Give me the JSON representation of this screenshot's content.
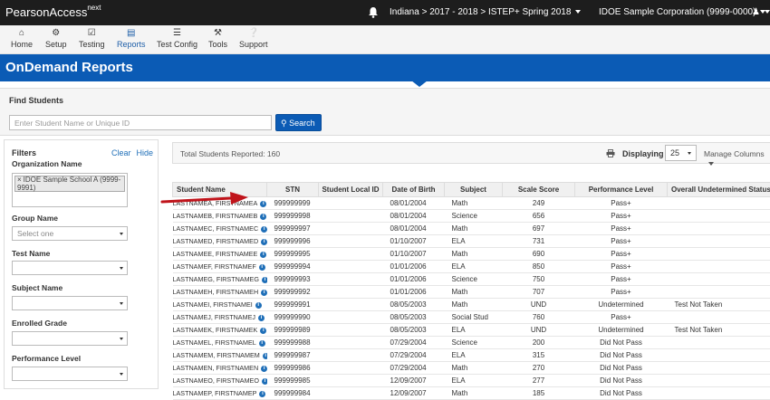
{
  "app": {
    "brand": "PearsonAccess",
    "brand_sup": "next",
    "context": "Indiana > 2017 - 2018 > ISTEP+ Spring 2018",
    "organization": "IDOE Sample Corporation (9999-0000)"
  },
  "nav": {
    "items": [
      {
        "label": "Home",
        "icon": "home-icon"
      },
      {
        "label": "Setup",
        "icon": "gear-icon"
      },
      {
        "label": "Testing",
        "icon": "checkbox-icon"
      },
      {
        "label": "Reports",
        "icon": "report-icon"
      },
      {
        "label": "Test Config",
        "icon": "list-icon"
      },
      {
        "label": "Tools",
        "icon": "wrench-icon"
      },
      {
        "label": "Support",
        "icon": "help-icon"
      }
    ],
    "active": "Reports"
  },
  "banner": {
    "title": "OnDemand Reports"
  },
  "find": {
    "title": "Find Students",
    "placeholder": "Enter Student Name or Unique ID",
    "search_label": "Search"
  },
  "filters": {
    "title": "Filters",
    "clear": "Clear",
    "hide": "Hide",
    "org_label": "Organization Name",
    "org_chip": "IDOE Sample School A (9999-9991)",
    "org_chip_x": "×",
    "group_label": "Group Name",
    "group_value": "Select one",
    "test_label": "Test Name",
    "subject_label": "Subject Name",
    "grade_label": "Enrolled Grade",
    "perf_label": "Performance Level"
  },
  "results": {
    "total": "Total Students Reported: 160",
    "displaying_label": "Displaying",
    "displaying_value": "25",
    "manage_columns": "Manage Columns"
  },
  "table": {
    "headers": [
      "Student Name",
      "STN",
      "Student Local ID",
      "Date of Birth",
      "Subject",
      "Scale Score",
      "Performance Level",
      "Overall Undetermined Status"
    ],
    "rows": [
      [
        "LASTNAMEA, FIRSTNAMEA",
        "999999999",
        "",
        "08/01/2004",
        "Math",
        "249",
        "Pass+",
        ""
      ],
      [
        "LASTNAMEB, FIRSTNAMEB",
        "999999998",
        "",
        "08/01/2004",
        "Science",
        "656",
        "Pass+",
        ""
      ],
      [
        "LASTNAMEC, FIRSTNAMEC",
        "999999997",
        "",
        "08/01/2004",
        "Math",
        "697",
        "Pass+",
        ""
      ],
      [
        "LASTNAMED, FIRSTNAMED",
        "999999996",
        "",
        "01/10/2007",
        "ELA",
        "731",
        "Pass+",
        ""
      ],
      [
        "LASTNAMEE, FIRSTNAMEE",
        "999999995",
        "",
        "01/10/2007",
        "Math",
        "690",
        "Pass+",
        ""
      ],
      [
        "LASTNAMEF, FIRSTNAMEF",
        "999999994",
        "",
        "01/01/2006",
        "ELA",
        "850",
        "Pass+",
        ""
      ],
      [
        "LASTNAMEG, FIRSTNAMEG",
        "999999993",
        "",
        "01/01/2006",
        "Science",
        "750",
        "Pass+",
        ""
      ],
      [
        "LASTNAMEH, FIRSTNAMEH",
        "999999992",
        "",
        "01/01/2006",
        "Math",
        "707",
        "Pass+",
        ""
      ],
      [
        "LASTNAMEI, FIRSTNAMEI",
        "999999991",
        "",
        "08/05/2003",
        "Math",
        "UND",
        "Undetermined",
        "Test Not Taken"
      ],
      [
        "LASTNAMEJ, FIRSTNAMEJ",
        "999999990",
        "",
        "08/05/2003",
        "Social Stud",
        "760",
        "Pass+",
        ""
      ],
      [
        "LASTNAMEK, FIRSTNAMEK",
        "999999989",
        "",
        "08/05/2003",
        "ELA",
        "UND",
        "Undetermined",
        "Test Not Taken"
      ],
      [
        "LASTNAMEL, FIRSTNAMEL",
        "999999988",
        "",
        "07/29/2004",
        "Science",
        "200",
        "Did Not Pass",
        ""
      ],
      [
        "LASTNAMEM, FIRSTNAMEM",
        "999999987",
        "",
        "07/29/2004",
        "ELA",
        "315",
        "Did Not Pass",
        ""
      ],
      [
        "LASTNAMEN, FIRSTNAMEN",
        "999999986",
        "",
        "07/29/2004",
        "Math",
        "270",
        "Did Not Pass",
        ""
      ],
      [
        "LASTNAMEO, FIRSTNAMEO",
        "999999985",
        "",
        "12/09/2007",
        "ELA",
        "277",
        "Did Not Pass",
        ""
      ],
      [
        "LASTNAMEP, FIRSTNAMEP",
        "999999984",
        "",
        "12/09/2007",
        "Math",
        "185",
        "Did Not Pass",
        ""
      ]
    ]
  },
  "colors": {
    "banner": "#0b5bb5",
    "topbar": "#1d1d1d",
    "link": "#1f6fb8",
    "arrow": "#c0141b"
  }
}
